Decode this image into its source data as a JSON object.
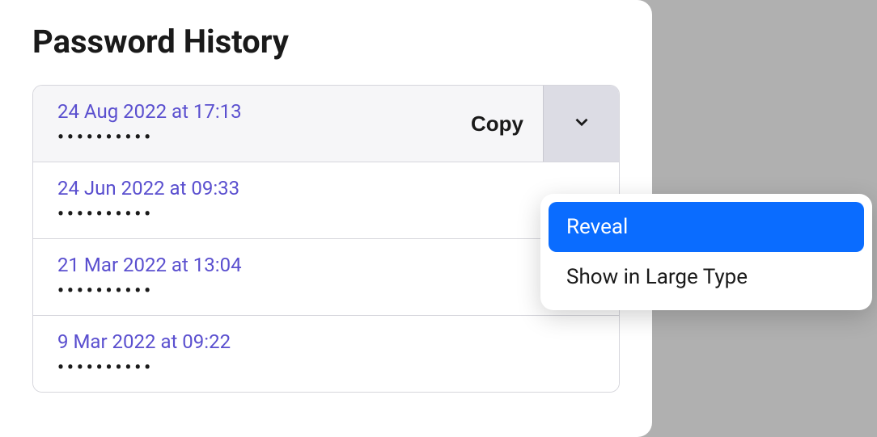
{
  "title": "Password History",
  "copy_label": "Copy",
  "password_mask": "••••••••••",
  "entries": [
    {
      "date": "24 Aug 2022 at 17:13"
    },
    {
      "date": "24 Jun 2022 at 09:33"
    },
    {
      "date": "21 Mar 2022 at 13:04"
    },
    {
      "date": "9 Mar 2022 at 09:22"
    }
  ],
  "menu": {
    "reveal": "Reveal",
    "large_type": "Show in Large Type"
  }
}
